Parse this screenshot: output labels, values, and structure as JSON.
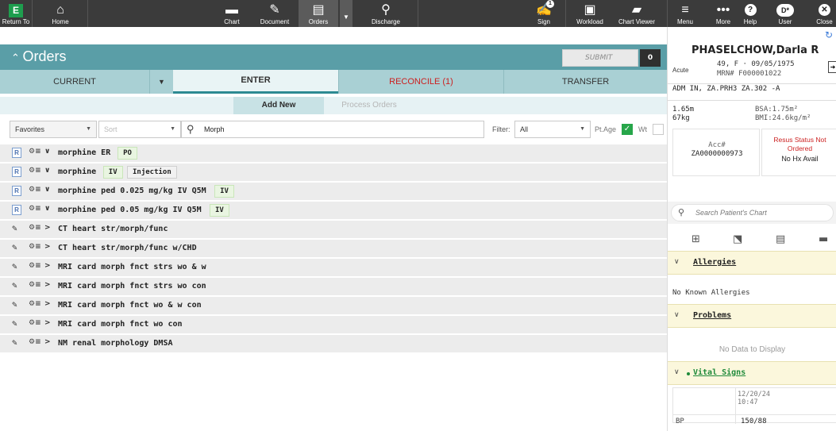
{
  "toolbar": {
    "return_to": "Return To",
    "home": "Home",
    "chart": "Chart",
    "document": "Document",
    "orders": "Orders",
    "discharge": "Discharge",
    "sign": "Sign",
    "sign_badge": "1",
    "workload": "Workload",
    "chart_viewer": "Chart Viewer",
    "menu": "Menu",
    "more": "More",
    "help": "Help",
    "user": "User",
    "user_icon_text": "D*",
    "close": "Close",
    "return_icon_text": "E",
    "icons": [
      "home-icon",
      "folder-icon",
      "pen-icon",
      "clipboard-icon",
      "discharge-icon",
      "sign-icon",
      "workload-icon",
      "chart-viewer-icon",
      "menu-icon",
      "more-icon",
      "help-icon",
      "user-icon",
      "close-icon"
    ]
  },
  "orders": {
    "title": "Orders",
    "submit": "SUBMIT",
    "submit_count": "0"
  },
  "tabs": {
    "current": "CURRENT",
    "enter": "ENTER",
    "reconcile": "RECONCILE (1)",
    "transfer": "TRANSFER"
  },
  "subtabs": {
    "add_new": "Add New",
    "process_orders": "Process Orders"
  },
  "filters": {
    "favorites": "Favorites",
    "sort": "Sort",
    "search_value": "Morph",
    "filter_label": "Filter:",
    "filter_value": "All",
    "pt_age": "Pt.Age",
    "pt_age_checked": true,
    "wt": "Wt",
    "wt_checked": false
  },
  "results": [
    {
      "type": "rx",
      "chevron": "∨",
      "name": "morphine ER",
      "pills": [
        "PO"
      ]
    },
    {
      "type": "rx",
      "chevron": "∨",
      "name": "morphine",
      "pills": [
        "IV",
        "Injection"
      ]
    },
    {
      "type": "rx",
      "chevron": "∨",
      "name": "morphine ped 0.025 mg/kg IV Q5M",
      "pills": [
        "IV"
      ]
    },
    {
      "type": "rx",
      "chevron": "∨",
      "name": "morphine ped 0.05 mg/kg IV Q5M",
      "pills": [
        "IV"
      ]
    },
    {
      "type": "procedure",
      "chevron": ">",
      "name": "CT heart str/morph/func",
      "pills": []
    },
    {
      "type": "procedure",
      "chevron": ">",
      "name": "CT heart str/morph/func w/CHD",
      "pills": []
    },
    {
      "type": "procedure",
      "chevron": ">",
      "name": "MRI card morph fnct strs wo & w",
      "pills": []
    },
    {
      "type": "procedure",
      "chevron": ">",
      "name": "MRI card morph fnct strs wo con",
      "pills": []
    },
    {
      "type": "procedure",
      "chevron": ">",
      "name": "MRI card morph fnct wo & w con",
      "pills": []
    },
    {
      "type": "procedure",
      "chevron": ">",
      "name": "MRI card morph fnct wo con",
      "pills": []
    },
    {
      "type": "procedure",
      "chevron": ">",
      "name": "NM renal morphology DMSA",
      "pills": []
    }
  ],
  "patient": {
    "name": "PHASELCHOW,Darla R",
    "status": "Acute",
    "demographics": "49, F · 09/05/1975",
    "mrn": "MRN# F000001022",
    "admission": "ADM IN, ZA.PRH3  ZA.302 -A",
    "height": "1.65m",
    "weight": "67kg",
    "bsa": "BSA:1.75m²",
    "bmi": "BMI:24.6kg/m²",
    "acc_label": "Acc#",
    "acc_value": "ZA0000000973",
    "resus_status": "Resus Status Not Ordered",
    "hx": "No Hx Avail",
    "search_placeholder": "Search Patient's Chart"
  },
  "sections": {
    "allergies": "Allergies",
    "allergies_text": "No Known Allergies",
    "problems": "Problems",
    "problems_text": "No Data to Display",
    "vitals": "Vital Signs",
    "vitals_date": "12/20/24",
    "vitals_time": "10:47",
    "bp_label": "BP",
    "bp_value": "150/88"
  }
}
